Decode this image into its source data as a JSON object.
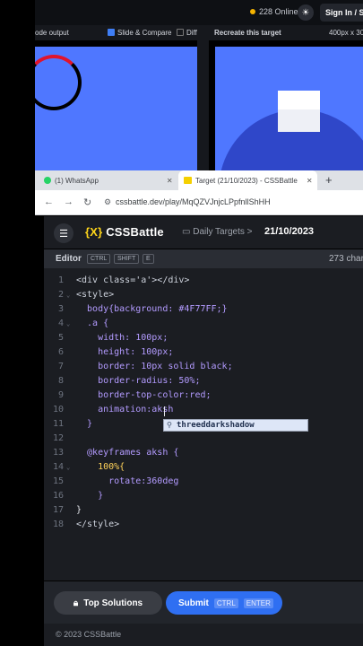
{
  "topbar": {
    "online": "228 Online",
    "signin": "Sign In / Sig"
  },
  "subhead": {
    "code_output": "ode output",
    "slide_compare": "Slide & Compare",
    "diff": "Diff",
    "recreate": "Recreate this target",
    "size": "400px x 30"
  },
  "browser": {
    "tabs": [
      {
        "label": "(1) WhatsApp"
      },
      {
        "label": "Target (21/10/2023) - CSSBattle"
      }
    ],
    "url": "cssbattle.dev/play/MqQZVJnjcLPpfnllShHH"
  },
  "app": {
    "logo_bracket": "{X}",
    "logo_text": "CSSBattle",
    "daily": "Daily Targets",
    "chevron": ">",
    "date": "21/10/2023"
  },
  "editor": {
    "title": "Editor",
    "keys": [
      "CTRL",
      "SHIFT",
      "E"
    ],
    "chars": "273 char",
    "lines": [
      {
        "n": "1",
        "text": "<div class='a'></div>"
      },
      {
        "n": "2",
        "text": "<style>"
      },
      {
        "n": "3",
        "text": "  body{background: #4F77FF;}"
      },
      {
        "n": "4",
        "text": "  .a {"
      },
      {
        "n": "5",
        "text": "    width: 100px;"
      },
      {
        "n": "6",
        "text": "    height: 100px;"
      },
      {
        "n": "7",
        "text": "    border: 10px solid black;"
      },
      {
        "n": "8",
        "text": "    border-radius: 50%;"
      },
      {
        "n": "9",
        "text": "    border-top-color:red;"
      },
      {
        "n": "10",
        "text": "    animation:aksh"
      },
      {
        "n": "11",
        "text": "  }"
      },
      {
        "n": "12",
        "text": ""
      },
      {
        "n": "13",
        "text": "  @keyframes aksh {"
      },
      {
        "n": "14",
        "text": "    100%{"
      },
      {
        "n": "15",
        "text": "      rotate:360deg"
      },
      {
        "n": "16",
        "text": "    }"
      },
      {
        "n": "17",
        "text": "}"
      },
      {
        "n": "18",
        "text": "</style>"
      }
    ],
    "autocomplete": "threeddarkshadow"
  },
  "footer": {
    "top_solutions": "Top Solutions",
    "submit": "Submit",
    "submit_keys": [
      "CTRL",
      "ENTER"
    ],
    "copyright": "© 2023 CSSBattle"
  },
  "colors": {
    "target_bg": "#4F77FF",
    "accent_yellow": "#FFD61A",
    "submit_blue": "#2F6FF2"
  }
}
